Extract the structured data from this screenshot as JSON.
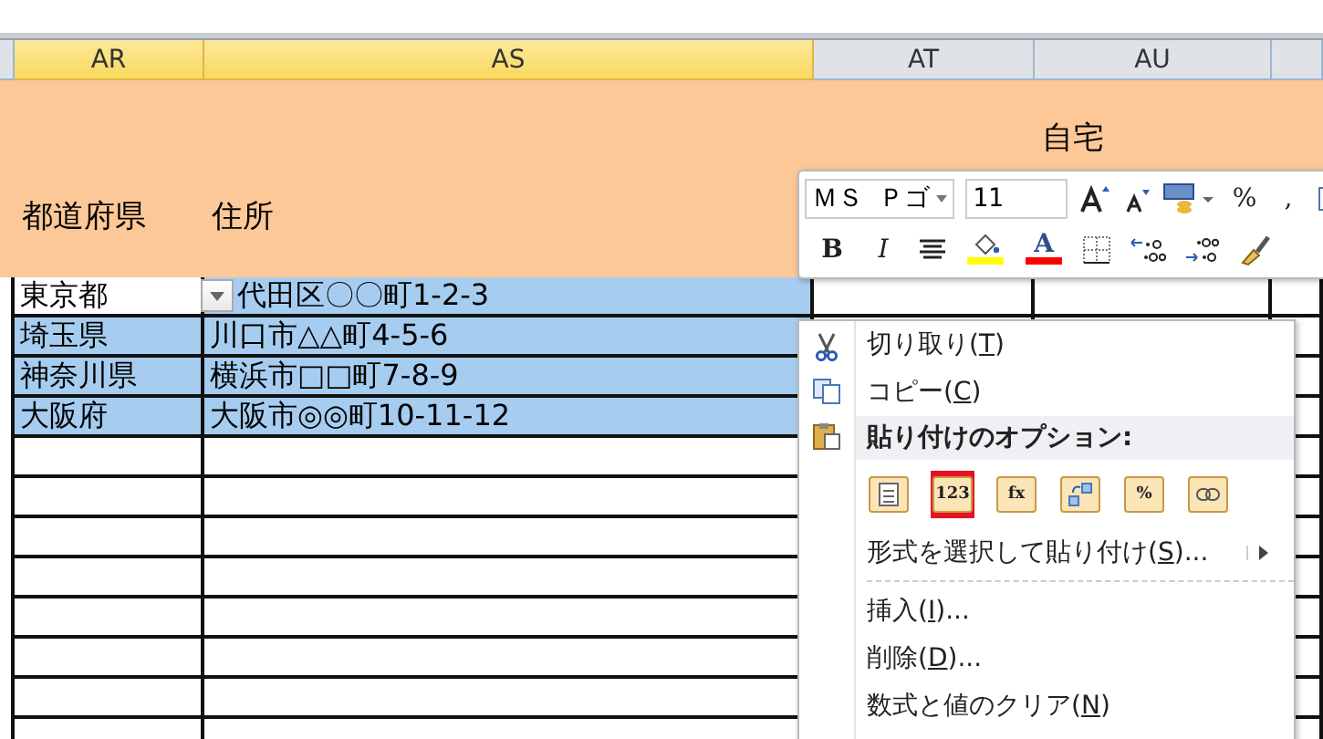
{
  "columns": [
    {},
    {
      "letter": "AR",
      "selected": true,
      "header": "都道府県"
    },
    {
      "letter": "AS",
      "selected": true,
      "header": "住所"
    },
    {
      "letter": "AT",
      "selected": false
    },
    {
      "letter": "AU",
      "selected": false,
      "header": "自宅"
    },
    {
      "selected": false
    }
  ],
  "rows": [
    {
      "prefecture": "東京都",
      "address": "代田区〇〇町1-2-3",
      "selected": true,
      "active": true
    },
    {
      "prefecture": "埼玉県",
      "address": "川口市△△町4-5-6",
      "selected": true,
      "active": false
    },
    {
      "prefecture": "神奈川県",
      "address": "横浜市□□町7-8-9",
      "selected": true,
      "active": false
    },
    {
      "prefecture": "大阪府",
      "address": "大阪市◎◎町10-11-12",
      "selected": true,
      "active": false
    }
  ],
  "mini_toolbar": {
    "font_name": "ＭＳ Ｐゴ",
    "font_size": "11",
    "row1": [
      {
        "kind": "grow"
      },
      {
        "kind": "shrink"
      },
      {
        "kind": "currency"
      },
      {
        "kind": "text",
        "label": "%"
      },
      {
        "kind": "text",
        "label": ","
      },
      {
        "kind": "cut_edge"
      }
    ],
    "row2": [
      {
        "kind": "bold",
        "label": "B"
      },
      {
        "kind": "italic",
        "label": "I"
      },
      {
        "kind": "center"
      },
      {
        "kind": "fill",
        "color": "#ffff00"
      },
      {
        "kind": "fontcolor",
        "label": "A",
        "color": "#ff0000"
      },
      {
        "kind": "border"
      },
      {
        "kind": "incdec"
      },
      {
        "kind": "decdec"
      },
      {
        "kind": "brush"
      }
    ]
  },
  "context_menu": {
    "items": [
      {
        "kind": "cut",
        "before": "切り取り(",
        "key": "T",
        "after": ")"
      },
      {
        "kind": "copy",
        "before": "コピー(",
        "key": "C",
        "after": ")"
      },
      {
        "kind": "header",
        "before": "貼り付けのオプション:"
      },
      {
        "kind": "paste_options",
        "options": [
          {
            "kind": "paste",
            "selected": false
          },
          {
            "kind": "values",
            "label": "123",
            "selected": true
          },
          {
            "kind": "formulas",
            "label": "fx",
            "selected": false
          },
          {
            "kind": "transpose",
            "selected": false
          },
          {
            "kind": "formatting",
            "label": "%",
            "selected": false
          },
          {
            "kind": "link",
            "selected": false
          }
        ]
      },
      {
        "kind": "submenu",
        "before": "形式を選択して貼り付け(",
        "key": "S",
        "after": ")..."
      },
      {
        "kind": "separator"
      },
      {
        "kind": "command",
        "before": "挿入(",
        "key": "I",
        "after": ")..."
      },
      {
        "kind": "command",
        "before": "削除(",
        "key": "D",
        "after": ")..."
      },
      {
        "kind": "command",
        "before": "数式と値のクリア(",
        "key": "N",
        "after": ")"
      }
    ]
  }
}
